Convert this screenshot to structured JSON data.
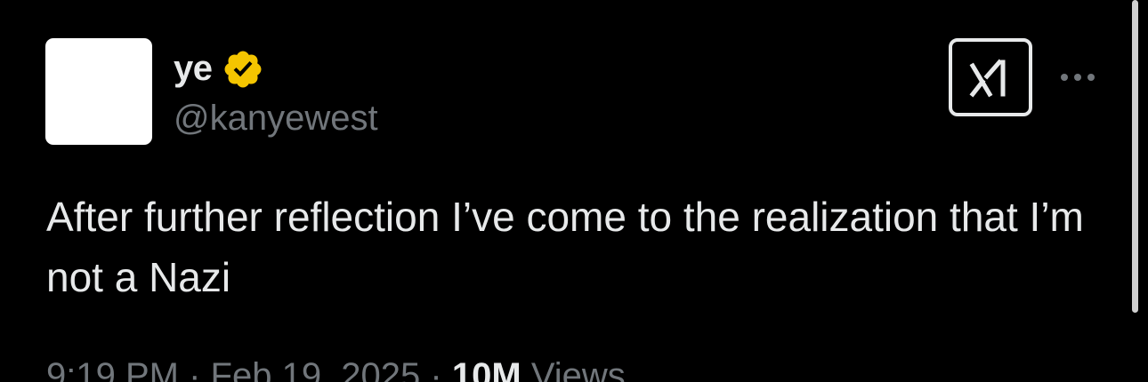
{
  "author": {
    "display_name": "ye",
    "handle": "@kanyewest",
    "verified": true,
    "verified_color": "#f4c500"
  },
  "post": {
    "text": "After further reflection I’ve come to the realization that I’m not a Nazi",
    "time": "9:19 PM",
    "separator": "·",
    "date": "Feb 19, 2025",
    "views_count": "10M",
    "views_label": "Views"
  },
  "actions": {
    "grok_icon": "grok-icon",
    "more_icon": "more-icon"
  }
}
